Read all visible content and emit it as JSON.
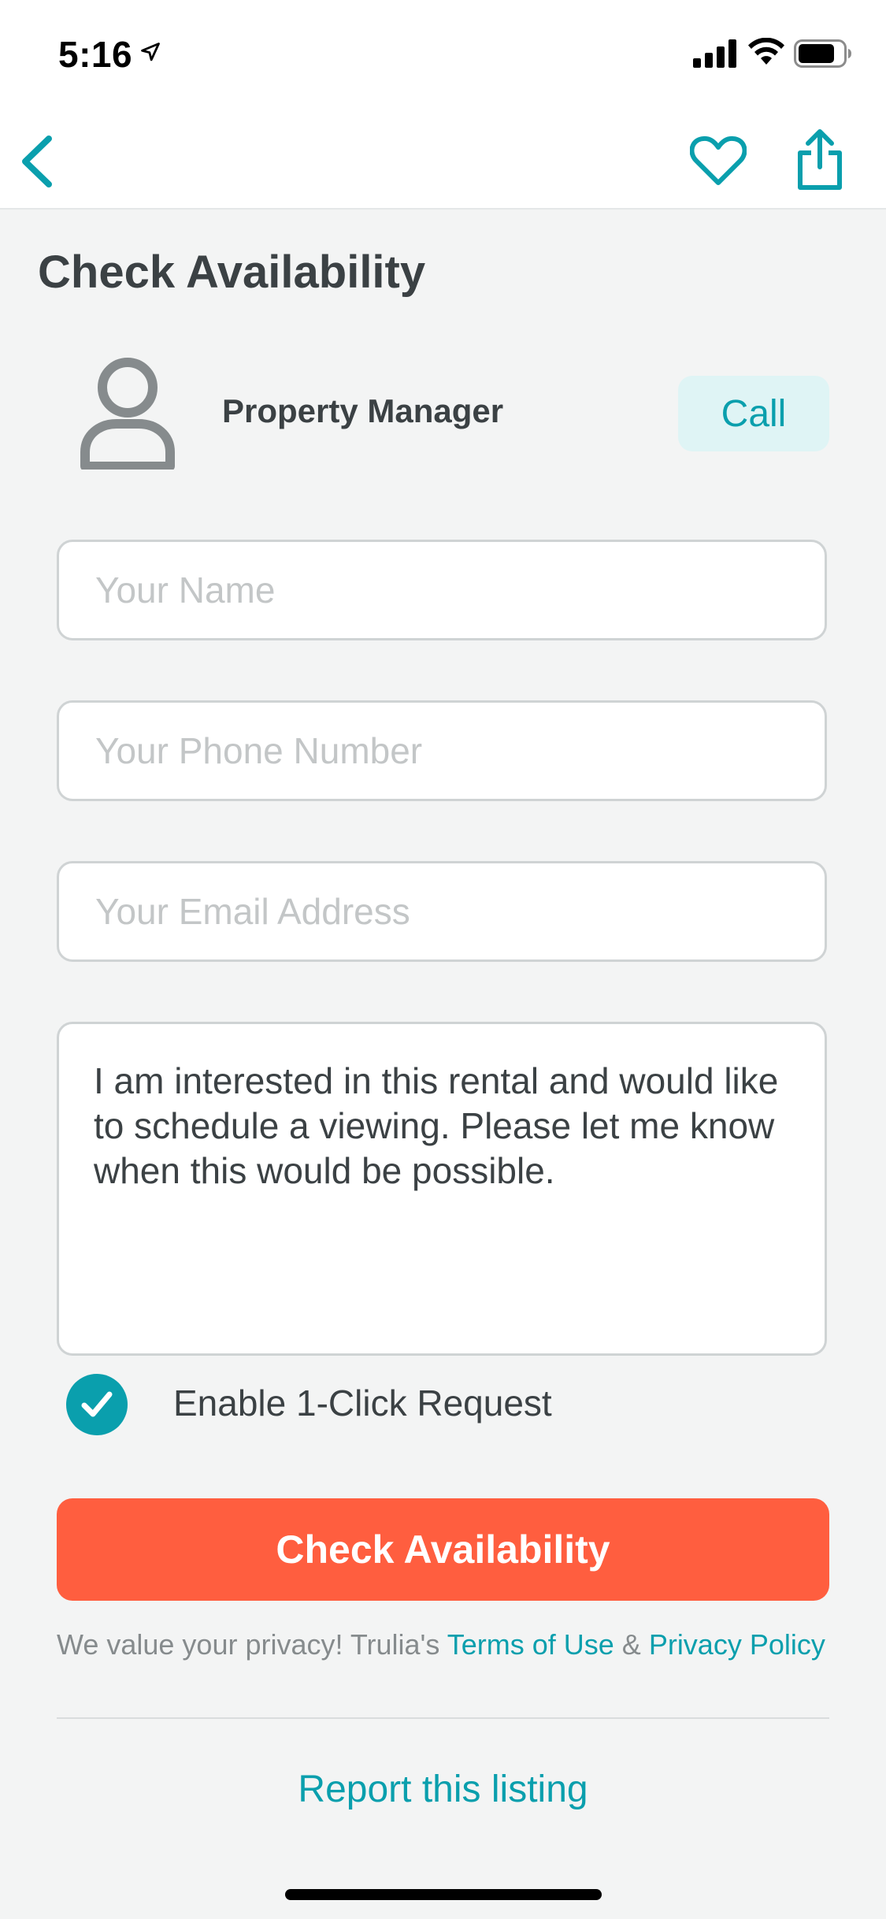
{
  "status_bar": {
    "time": "5:16",
    "icons": [
      "location-arrow-icon",
      "cellular-signal-icon",
      "wifi-icon",
      "battery-icon"
    ]
  },
  "nav": {
    "icons": [
      "chevron-left-icon",
      "heart-icon",
      "share-icon"
    ],
    "accent_color": "#0a9fad"
  },
  "page": {
    "title": "Check Availability"
  },
  "contact": {
    "avatar_icon": "person-icon",
    "name": "Property Manager",
    "call_label": "Call"
  },
  "form": {
    "name_placeholder": "Your Name",
    "phone_placeholder": "Your Phone Number",
    "email_placeholder": "Your Email Address",
    "message": "I am interested in this rental and would like to schedule a viewing. Please let me know when this would be possible.",
    "one_click_label": "Enable 1-Click Request",
    "one_click_checked": true,
    "submit_label": "Check Availability",
    "submit_color": "#ff5e3f"
  },
  "privacy": {
    "text_before": "We value your privacy! Trulia's ",
    "terms_link": "Terms of Use",
    "amp": " & ",
    "policy_link": "Privacy Policy"
  },
  "footer": {
    "report_link": "Report this listing"
  }
}
